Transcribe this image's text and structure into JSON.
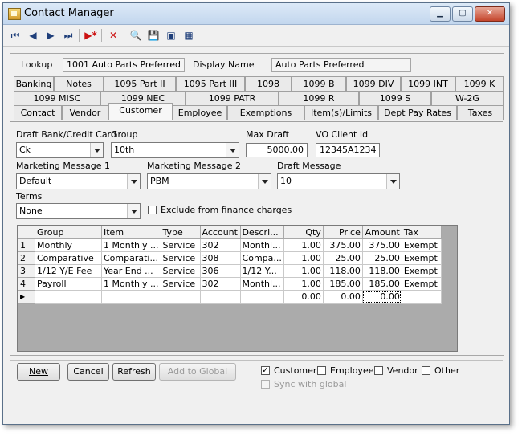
{
  "window": {
    "title": "Contact Manager"
  },
  "toolbar": {
    "first": "⏮",
    "prev": "◀",
    "next": "▶",
    "last": "⏭",
    "new_record": "▶*",
    "delete": "✕",
    "find": "🔍",
    "save": "💾",
    "export": "▣",
    "properties": "▦"
  },
  "lookup": {
    "label": "Lookup",
    "value": "1001 Auto Parts Preferred",
    "display_label": "Display Name",
    "display_value": "Auto Parts Preferred"
  },
  "tabs": {
    "row1": [
      "Banking",
      "Notes",
      "1095 Part II",
      "1095 Part III",
      "1098",
      "1099 B",
      "1099 DIV",
      "1099 INT",
      "1099 K"
    ],
    "row2": [
      "1099 MISC",
      "1099 NEC",
      "1099 PATR",
      "1099 R",
      "1099 S",
      "W-2G"
    ],
    "row3": [
      "Contact",
      "Vendor",
      "Customer",
      "Employee",
      "Exemptions",
      "Item(s)/Limits",
      "Dept Pay Rates",
      "Taxes"
    ],
    "active": "Customer"
  },
  "form": {
    "draft_bank_label": "Draft Bank/Credit Card",
    "draft_bank_value": "Ck",
    "group_label": "Group",
    "group_value": "10th",
    "max_draft_label": "Max Draft",
    "max_draft_value": "5000.00",
    "vo_client_label": "VO Client Id",
    "vo_client_value": "12345A1234",
    "mm1_label": "Marketing Message 1",
    "mm1_value": "Default",
    "mm2_label": "Marketing Message 2",
    "mm2_value": "PBM",
    "draft_msg_label": "Draft Message",
    "draft_msg_value": "10",
    "terms_label": "Terms",
    "terms_value": "None",
    "exclude_label": "Exclude from finance charges"
  },
  "grid": {
    "columns": [
      "Group",
      "Item",
      "Type",
      "Account",
      "Descri...",
      "Qty",
      "Price",
      "Amount",
      "Tax"
    ],
    "rows": [
      {
        "n": "1",
        "group": "Monthly",
        "item": "1 Monthly ...",
        "type": "Service",
        "account": "302",
        "desc": "Monthl...",
        "qty": "1.00",
        "price": "375.00",
        "amount": "375.00",
        "tax": "Exempt"
      },
      {
        "n": "2",
        "group": "Comparative",
        "item": "Comparati...",
        "type": "Service",
        "account": "308",
        "desc": "Compa...",
        "qty": "1.00",
        "price": "25.00",
        "amount": "25.00",
        "tax": "Exempt"
      },
      {
        "n": "3",
        "group": "1/12 Y/E Fee",
        "item": "Year End ...",
        "type": "Service",
        "account": "306",
        "desc": "1/12 Y...",
        "qty": "1.00",
        "price": "118.00",
        "amount": "118.00",
        "tax": "Exempt"
      },
      {
        "n": "4",
        "group": "Payroll",
        "item": "1 Monthly ...",
        "type": "Service",
        "account": "302",
        "desc": "Monthl...",
        "qty": "1.00",
        "price": "185.00",
        "amount": "185.00",
        "tax": "Exempt"
      }
    ],
    "new_row": {
      "qty": "0.00",
      "price": "0.00",
      "amount": "0.00"
    }
  },
  "buttons": {
    "new": "New",
    "cancel": "Cancel",
    "refresh": "Refresh",
    "add_global": "Add to Global"
  },
  "checks": {
    "customer": "Customer",
    "employee": "Employee",
    "vendor": "Vendor",
    "other": "Other",
    "sync": "Sync with global"
  }
}
